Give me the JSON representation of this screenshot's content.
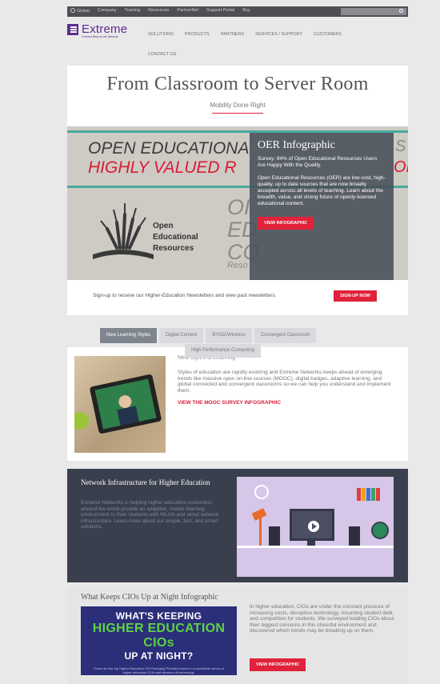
{
  "topbar": {
    "links": [
      "Global",
      "Company",
      "Training",
      "Resources",
      "PartnerNet",
      "Support Portal",
      "Buy"
    ]
  },
  "header": {
    "logo_name": "Extreme",
    "logo_tagline": "Connect Beyond the Network",
    "nav": [
      "SOLUTIONS",
      "PRODUCTS",
      "PARTNERS",
      "SERVICES / SUPPORT",
      "CUSTOMERS"
    ],
    "nav_second_row": "CONTACT US"
  },
  "hero": {
    "title": "From Classroom to Server Room",
    "subtitle": "Mobility Done Right"
  },
  "banner": {
    "big_line1": "OPEN EDUCATIONA",
    "big_line2": "HIGHLY VALUED R",
    "ghost_right": "S ARE",
    "ghost_right2": "ORS",
    "ghost_mid1": "OI",
    "ghost_mid2": "ED",
    "ghost_mid3": "CO",
    "ghost_small": "Reso",
    "oer_label_1": "Open",
    "oer_label_2": "Educational",
    "oer_label_3": "Resources",
    "overlay": {
      "title": "OER Infographic",
      "p1": "Survey: 94% of Open Educational Resources Users Are Happy With the Quality.",
      "p2": "Open Educational Resources (OER) are low-cost, high-quality, up to date sources that are now broadly accepted across all levels of teaching. Learn about the breadth, value, and strong future of openly-licensed educational content.",
      "button": "VIEW INFOGRAPHIC"
    }
  },
  "newsletter": {
    "text": "Sign-up to receive our Higher-Education Newsletters and view past newsletters.",
    "button": "SIGN-UP NOW"
  },
  "tabs": {
    "items": [
      "New Learning Styles",
      "Digital Content",
      "BYOD/Wireless",
      "Convergent Classroom"
    ],
    "second_row": "High Performance Computing",
    "active_index": 0
  },
  "learning": {
    "heading": "New Styles of Learning",
    "body": "Styles of education are rapidly evolving and Extreme Networks keeps ahead of emerging trends like massive open on-line courses (MOOC), digital badges, adaptive learning, and global connected and convergent classrooms so we can help you understand and implement them.",
    "link": "VIEW THE MOOC SURVEY INFOGRAPHIC"
  },
  "network": {
    "title": "Network Infrastructure for Higher Education",
    "body": "Extreme Networks is helping higher education customers around the world provide an adaptive, mobile learning environment to their students with WLAN and wired network infrastructure. Learn more about our simple, fast, and smart solutions."
  },
  "cio": {
    "title": "What Keeps CIOs Up at Night Infographic",
    "img_line1": "WHAT'S KEEPING",
    "img_line2": "HIGHER EDUCATION CIOs",
    "img_line3": "UP AT NIGHT?",
    "img_caption": "These are the top Higher Education CIO Emerging Priorities based on a worldwide survey of higher education CIOs and directors of technology.",
    "body": "In higher education, CIOs are under the constant pressure of increasing costs, disruptive technology, mounting student debt, and competition for students. We surveyed leading CIOs about their biggest concerns in this stressful environment and discovered which trends may be breaking up on them.",
    "button": "VIEW INFOGRAPHIC"
  },
  "colors": {
    "brand_purple": "#5b2d90",
    "accent_red": "#e0223a",
    "teal": "#49a99f",
    "dark_panel": "#3a3f4d"
  }
}
